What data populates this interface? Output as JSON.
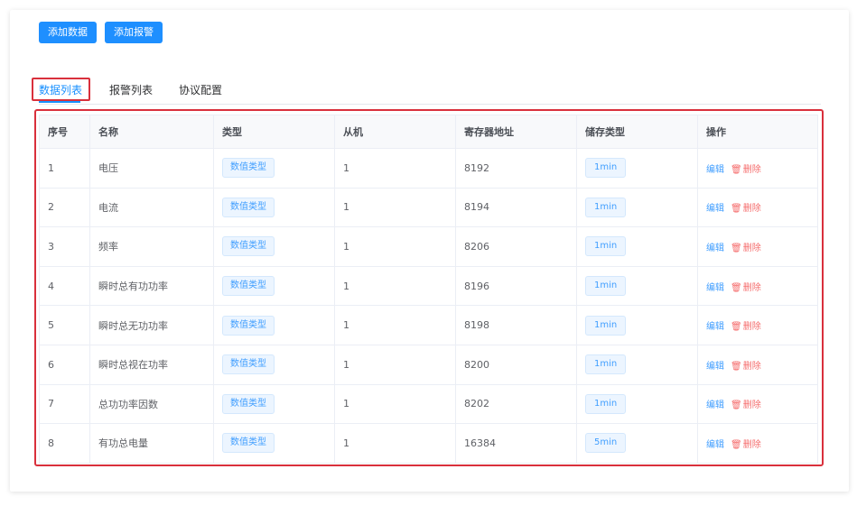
{
  "toolbar": {
    "add_data": "添加数据",
    "add_alarm": "添加报警"
  },
  "tabs": [
    {
      "label": "数据列表",
      "active": true
    },
    {
      "label": "报警列表",
      "active": false
    },
    {
      "label": "协议配置",
      "active": false
    }
  ],
  "table": {
    "headers": [
      "序号",
      "名称",
      "类型",
      "从机",
      "寄存器地址",
      "储存类型",
      "操作"
    ],
    "rows": [
      {
        "index": "1",
        "name": "电压",
        "type": "数值类型",
        "slave": "1",
        "address": "8192",
        "storage": "1min"
      },
      {
        "index": "2",
        "name": "电流",
        "type": "数值类型",
        "slave": "1",
        "address": "8194",
        "storage": "1min"
      },
      {
        "index": "3",
        "name": "频率",
        "type": "数值类型",
        "slave": "1",
        "address": "8206",
        "storage": "1min"
      },
      {
        "index": "4",
        "name": "瞬时总有功功率",
        "type": "数值类型",
        "slave": "1",
        "address": "8196",
        "storage": "1min"
      },
      {
        "index": "5",
        "name": "瞬时总无功功率",
        "type": "数值类型",
        "slave": "1",
        "address": "8198",
        "storage": "1min"
      },
      {
        "index": "6",
        "name": "瞬时总视在功率",
        "type": "数值类型",
        "slave": "1",
        "address": "8200",
        "storage": "1min"
      },
      {
        "index": "7",
        "name": "总功功率因数",
        "type": "数值类型",
        "slave": "1",
        "address": "8202",
        "storage": "1min"
      },
      {
        "index": "8",
        "name": "有功总电量",
        "type": "数值类型",
        "slave": "1",
        "address": "16384",
        "storage": "5min"
      }
    ],
    "actions": {
      "edit": "编辑",
      "delete": "删除"
    }
  },
  "colors": {
    "primary": "#1e8fff",
    "highlight": "#d9303c",
    "danger": "#f56c6c"
  },
  "icons": {
    "delete": "trash-icon"
  }
}
